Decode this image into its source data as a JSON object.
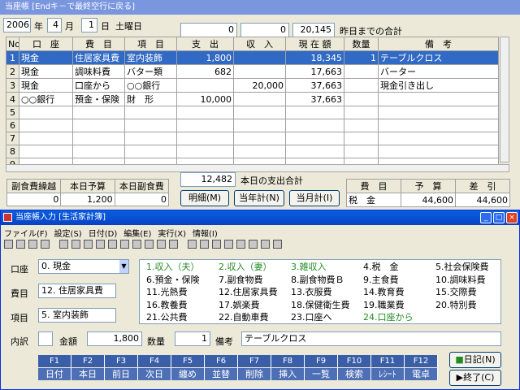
{
  "win1": {
    "title": "当座帳 [Endキ－で最終空行に戻る]",
    "year": "2006",
    "year_l": "年",
    "month": "4",
    "month_l": "月",
    "day": "1",
    "day_l": "日",
    "weekday": "土曜日",
    "top1": "0",
    "top2": "0",
    "top3": "20,145",
    "prev_total": "昨日までの合計"
  },
  "table": {
    "headers": [
      "No",
      "口　座",
      "費　目",
      "項　目",
      "支　出",
      "収　入",
      "現 在 額",
      "数量",
      "備　考"
    ],
    "rows": [
      [
        "1",
        "現金",
        "住居家具費",
        "室内装飾",
        "1,800",
        "",
        "18,345",
        "1",
        "テーブルクロス"
      ],
      [
        "2",
        "現金",
        "調味料費",
        "バター類",
        "682",
        "",
        "17,663",
        "",
        "バーター"
      ],
      [
        "3",
        "現金",
        "口座から",
        "○○銀行",
        "",
        "20,000",
        "37,663",
        "",
        "現金引き出し"
      ],
      [
        "4",
        "○○銀行",
        "預金・保険",
        "財　形",
        "10,000",
        "",
        "37,663",
        "",
        ""
      ],
      [
        "5",
        "",
        "",
        "",
        "",
        "",
        "",
        "",
        ""
      ],
      [
        "6",
        "",
        "",
        "",
        "",
        "",
        "",
        "",
        ""
      ],
      [
        "7",
        "",
        "",
        "",
        "",
        "",
        "",
        "",
        ""
      ],
      [
        "8",
        "",
        "",
        "",
        "",
        "",
        "",
        "",
        ""
      ],
      [
        "9",
        "",
        "",
        "",
        "",
        "",
        "",
        "",
        ""
      ]
    ]
  },
  "bottom": {
    "h1": "副食費繰越",
    "h2": "本日予算",
    "h3": "本日副食費",
    "v1": "0",
    "v2": "1,200",
    "v3": "0",
    "today_out": "12,482",
    "today_out_l": "本日の支出合計",
    "btn_detail": "明細(M)",
    "btn_year": "当年計(N)",
    "btn_month": "当月計(I)",
    "bh1": "費　目",
    "bh2": "予　算",
    "bh3": "差　引",
    "bv1": "税　金",
    "bv2": "44,600",
    "bv3": "44,600"
  },
  "win2": {
    "title": "当座帳入力 [生活家計簿]",
    "menu": [
      "ファイル(F)",
      "設定(S)",
      "日付(D)",
      "編集(E)",
      "実行(X)",
      "情報(I)"
    ],
    "account_l": "口座",
    "account": "0. 現金",
    "item_l": "費目",
    "item": "12. 住居家具費",
    "sub_l": "項目",
    "sub": "5. 室内装飾",
    "cats": [
      [
        "1.収入（夫）",
        "2.収入（妻）",
        "3.雑収入",
        "4.税　金",
        "5.社会保険費"
      ],
      [
        "6.預金・保険",
        "7.副食物費",
        "8.副食物費Ｂ",
        "9.主食費",
        "10.調味料費"
      ],
      [
        "11.光熱費",
        "12.住居家具費",
        "13.衣服費",
        "14.教育費",
        "15.交際費"
      ],
      [
        "16.教養費",
        "17.娯楽費",
        "18.保健衛生費",
        "19.職業費",
        "20.特別費"
      ],
      [
        "21.公共費",
        "22.自動車費",
        "23.口座へ",
        "24.口座から",
        ""
      ]
    ],
    "uchi_l": "内訳",
    "kin_l": "金額",
    "kin": "1,800",
    "suu_l": "数量",
    "suu": "1",
    "biko_l": "備考",
    "biko": "テーブルクロス",
    "fkeys": [
      "F1",
      "F2",
      "F3",
      "F4",
      "F5",
      "F6",
      "F7",
      "F8",
      "F9",
      "F10",
      "F11",
      "F12"
    ],
    "flabels": [
      "日付",
      "本日",
      "前日",
      "次日",
      "纏め",
      "並替",
      "削除",
      "挿入",
      "一覧",
      "検索",
      "ﾚｼｰﾄ",
      "電卓"
    ],
    "btn_diary": "日記(N)",
    "btn_exit": "終了(C)"
  },
  "colors": {
    "green": "#228b22",
    "select": "#316ac5",
    "title": "#0a5fe0"
  }
}
